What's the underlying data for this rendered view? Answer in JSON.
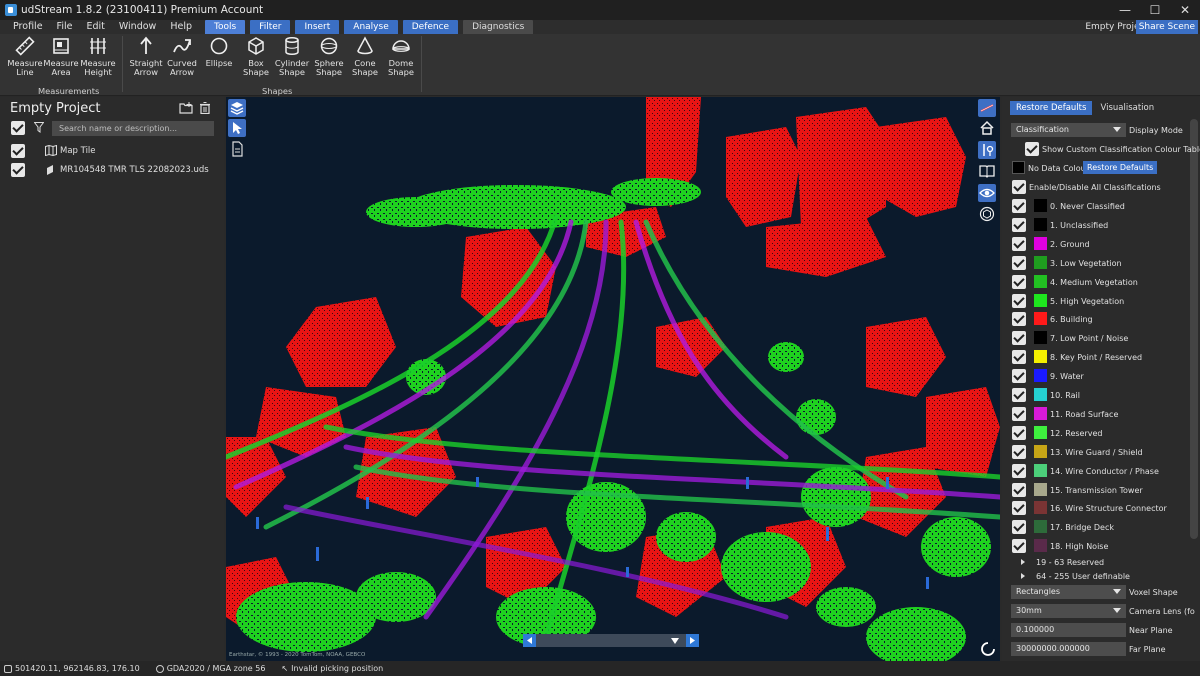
{
  "window": {
    "title": "udStream 1.8.2 (23100411) Premium Account",
    "minimize": "—",
    "maximize": "☐",
    "close": "✕"
  },
  "menu": {
    "items": [
      "Profile",
      "File",
      "Edit",
      "Window",
      "Help"
    ],
    "tabs": [
      "Tools",
      "Filter",
      "Insert",
      "Analyse",
      "Defence",
      "Diagnostics"
    ],
    "project_name": "Empty Project",
    "share_label": "Share Scene"
  },
  "ribbon": {
    "measurements": {
      "label": "Measurements",
      "buttons": [
        {
          "l1": "Measure",
          "l2": "Line",
          "icon": "ruler-icon"
        },
        {
          "l1": "Measure",
          "l2": "Area",
          "icon": "area-icon"
        },
        {
          "l1": "Measure",
          "l2": "Height",
          "icon": "height-icon"
        }
      ]
    },
    "shapes": {
      "label": "Shapes",
      "buttons": [
        {
          "l1": "Straight",
          "l2": "Arrow",
          "icon": "straight-arrow-icon"
        },
        {
          "l1": "Curved",
          "l2": "Arrow",
          "icon": "curved-arrow-icon"
        },
        {
          "l1": "Ellipse",
          "l2": "",
          "icon": "ellipse-icon"
        },
        {
          "l1": "Box",
          "l2": "Shape",
          "icon": "box-icon"
        },
        {
          "l1": "Cylinder",
          "l2": "Shape",
          "icon": "cylinder-icon"
        },
        {
          "l1": "Sphere",
          "l2": "Shape",
          "icon": "sphere-icon"
        },
        {
          "l1": "Cone",
          "l2": "Shape",
          "icon": "cone-icon"
        },
        {
          "l1": "Dome",
          "l2": "Shape",
          "icon": "dome-icon"
        }
      ]
    }
  },
  "left_panel": {
    "title": "Empty Project",
    "search_placeholder": "Search name or description...",
    "items": [
      {
        "label": "Map Tile",
        "icon": "map-icon"
      },
      {
        "label": "MR104548 TMR TLS 22082023.uds",
        "icon": "pointcloud-icon"
      }
    ]
  },
  "viewport": {
    "attribution": "Earthstar, © 1993 - 2020 TomTom, NOAA, GEBCO"
  },
  "right_panel": {
    "tabs": [
      "Restore Defaults",
      "Visualisation"
    ],
    "display_mode_value": "Classification",
    "display_mode_label": "Display Mode",
    "custom_table_label": "Show Custom Classification Colour Table",
    "no_data_label": "No Data Colour",
    "restore_defaults_label": "Restore Defaults",
    "enable_all_label": "Enable/Disable All Classifications",
    "classes": [
      {
        "label": "0. Never Classified",
        "color": "#000000"
      },
      {
        "label": "1. Unclassified",
        "color": "#000000"
      },
      {
        "label": "2. Ground",
        "color": "#e000e0"
      },
      {
        "label": "3. Low Vegetation",
        "color": "#1f9d1f"
      },
      {
        "label": "4. Medium Vegetation",
        "color": "#22c022"
      },
      {
        "label": "5. High Vegetation",
        "color": "#1ee61e"
      },
      {
        "label": "6. Building",
        "color": "#ff1a1a"
      },
      {
        "label": "7. Low Point / Noise",
        "color": "#000000"
      },
      {
        "label": "8. Key Point / Reserved",
        "color": "#f5f000"
      },
      {
        "label": "9. Water",
        "color": "#1a1aff"
      },
      {
        "label": "10. Rail",
        "color": "#25d0d0"
      },
      {
        "label": "11. Road Surface",
        "color": "#d81ad8"
      },
      {
        "label": "12. Reserved",
        "color": "#3ef03e"
      },
      {
        "label": "13. Wire Guard / Shield",
        "color": "#c7a516"
      },
      {
        "label": "14. Wire Conductor / Phase",
        "color": "#4ccf7a"
      },
      {
        "label": "15. Transmission Tower",
        "color": "#a8a88c"
      },
      {
        "label": "16. Wire Structure Connector",
        "color": "#7a3434"
      },
      {
        "label": "17. Bridge Deck",
        "color": "#2d6b3a"
      },
      {
        "label": "18. High Noise",
        "color": "#5a2a4a"
      }
    ],
    "reserved_group": "19 - 63 Reserved",
    "user_group": "64 - 255 User definable",
    "voxel_shape_value": "Rectangles",
    "voxel_shape_label": "Voxel Shape",
    "camera_lens_value": "30mm",
    "camera_lens_label": "Camera Lens (fo",
    "near_plane_value": "0.100000",
    "near_plane_label": "Near Plane",
    "far_plane_value": "30000000.000000",
    "far_plane_label": "Far Plane"
  },
  "status": {
    "coords": "501420.11, 962146.83, 176.10",
    "crs": "GDA2020 / MGA zone 56",
    "picking": "Invalid picking position"
  },
  "colors": {
    "accent": "#3b6fc4",
    "building": "#ff1a1a",
    "vegetation": "#1ee61e",
    "road": "#d81ad8"
  }
}
